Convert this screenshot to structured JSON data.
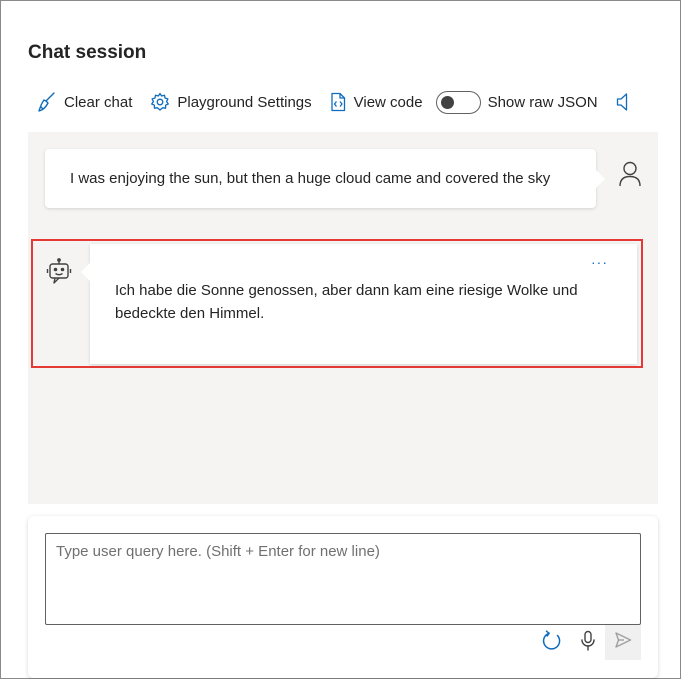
{
  "panel": {
    "title": "Chat session"
  },
  "toolbar": {
    "clear_label": "Clear chat",
    "settings_label": "Playground Settings",
    "viewcode_label": "View code",
    "raw_json_label": "Show raw JSON",
    "raw_json_enabled": false
  },
  "messages": [
    {
      "role": "user",
      "text": "I was enjoying the sun, but then a huge cloud came and covered the sky"
    },
    {
      "role": "assistant",
      "text": "Ich habe die Sonne genossen, aber dann kam eine riesige Wolke und bedeckte den Himmel.",
      "more_label": "···"
    }
  ],
  "input": {
    "placeholder": "Type user query here. (Shift + Enter for new line)",
    "value": ""
  },
  "icons": {
    "clear": "broom-icon",
    "settings": "gear-icon",
    "view_code": "code-file-icon",
    "speaker": "speaker-icon",
    "user": "person-icon",
    "bot": "bot-icon",
    "refresh": "refresh-icon",
    "mic": "microphone-icon",
    "send": "send-icon"
  },
  "colors": {
    "accent": "#0f6cbd",
    "highlight_border": "#e53935",
    "chat_background": "#f5f4f2"
  }
}
